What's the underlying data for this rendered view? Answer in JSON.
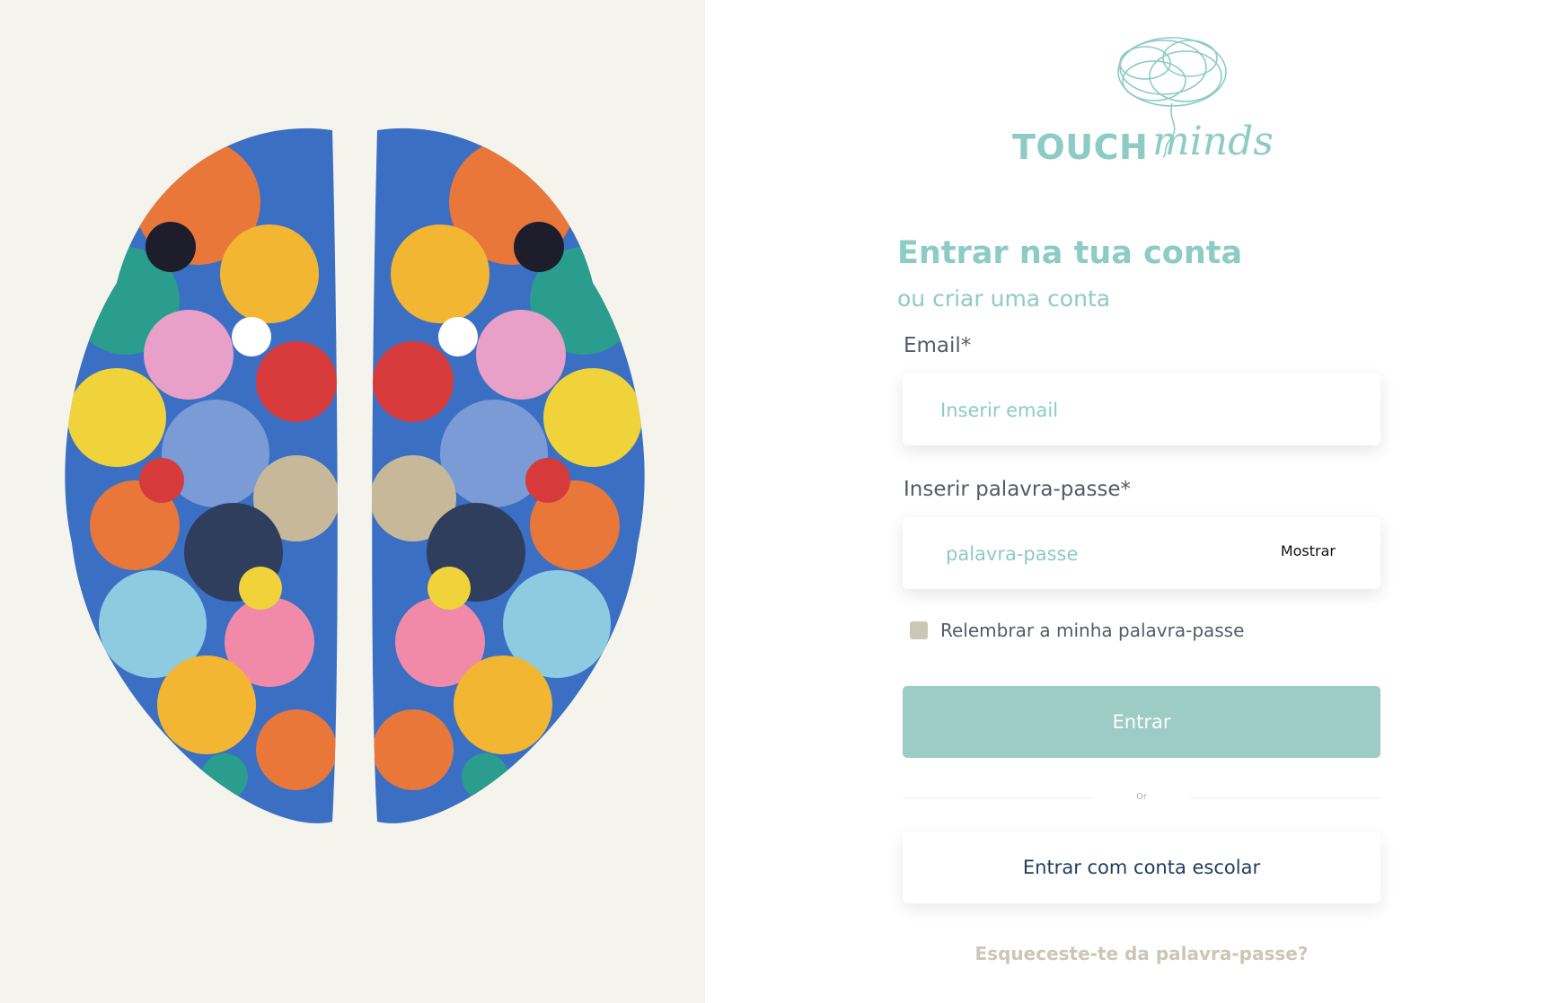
{
  "brand": {
    "logo_word": "TOUCH",
    "logo_script": "minds",
    "accent_color": "#8dcbc5",
    "logo_icon": "brain-scribble-icon"
  },
  "form": {
    "title": "Entrar na tua conta",
    "subtitle": "ou criar uma conta",
    "email": {
      "label": "Email*",
      "placeholder": "Inserir email",
      "value": ""
    },
    "password": {
      "label": "Inserir palavra-passe*",
      "placeholder": "palavra-passe",
      "value": "",
      "show_label": "Mostrar"
    },
    "remember_label": "Relembrar a minha palavra-passe",
    "remember_checked": false,
    "submit_label": "Entrar",
    "divider_label": "Or",
    "school_label": "Entrar com conta escolar",
    "forgot_label": "Esqueceste-te da palavra-passe?"
  },
  "illustration": {
    "icon": "colorful-brain-illustration",
    "background": "#f5f4ec"
  }
}
